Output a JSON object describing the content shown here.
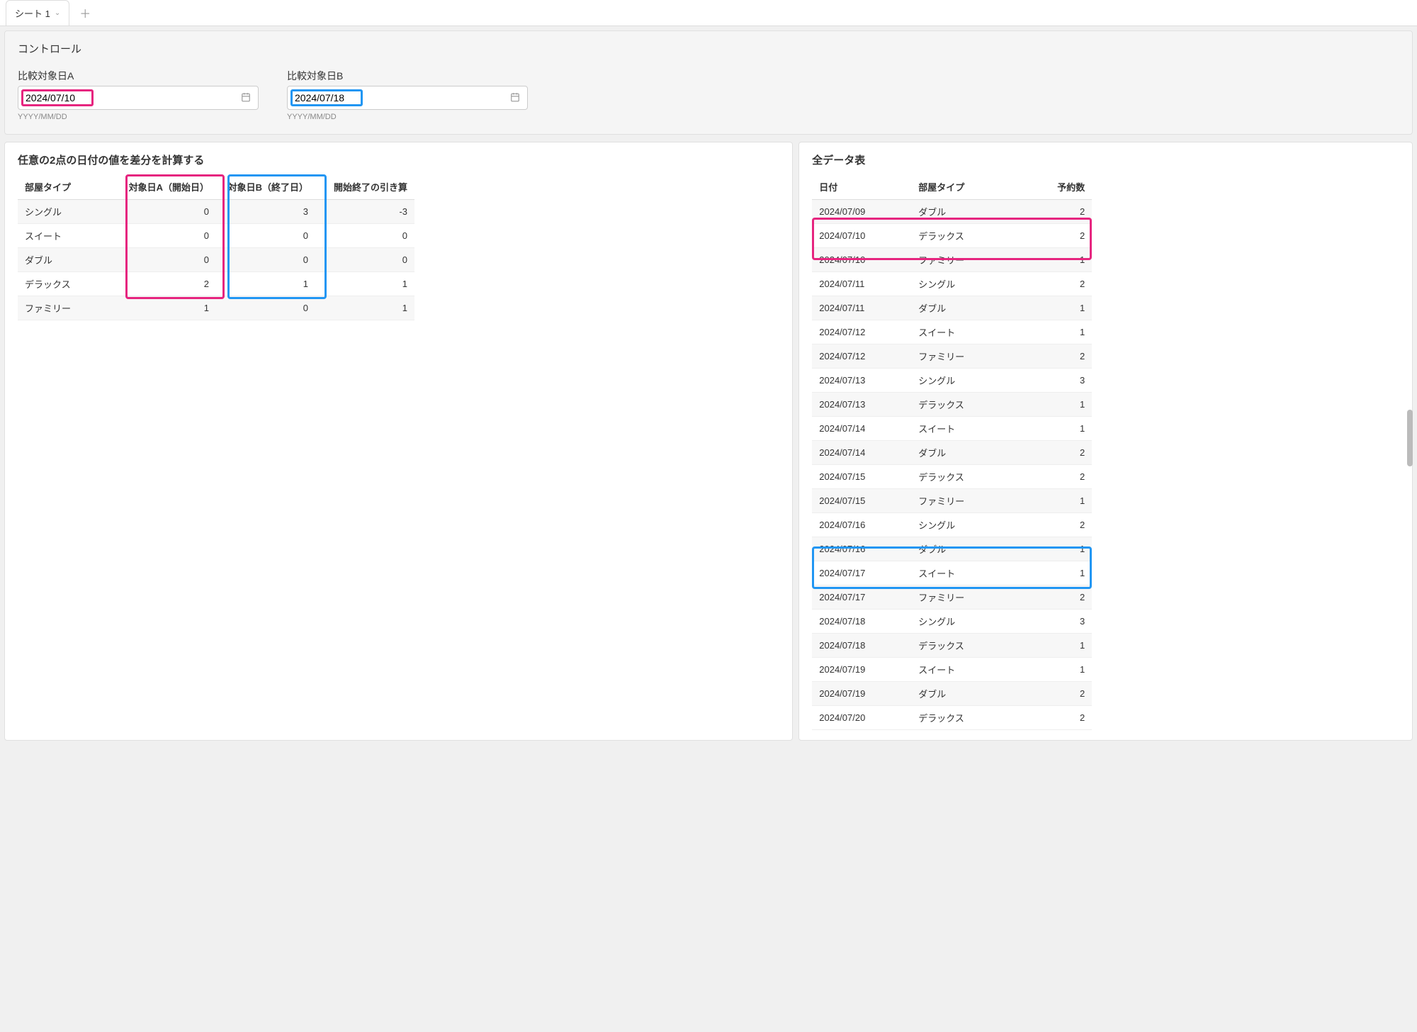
{
  "tabs": {
    "active": "シート 1"
  },
  "controls": {
    "title": "コントロール",
    "dateA": {
      "label": "比較対象日A",
      "value": "2024/07/10",
      "helper": "YYYY/MM/DD"
    },
    "dateB": {
      "label": "比較対象日B",
      "value": "2024/07/18",
      "helper": "YYYY/MM/DD"
    }
  },
  "leftPanel": {
    "title": "任意の2点の日付の値を差分を計算する",
    "headers": [
      "部屋タイプ",
      "対象日A（開始日）",
      "対象日B（終了日）",
      "開始終了の引き算"
    ],
    "rows": [
      {
        "room": "シングル",
        "a": 0,
        "b": 3,
        "diff": -3
      },
      {
        "room": "スイート",
        "a": 0,
        "b": 0,
        "diff": 0
      },
      {
        "room": "ダブル",
        "a": 0,
        "b": 0,
        "diff": 0
      },
      {
        "room": "デラックス",
        "a": 2,
        "b": 1,
        "diff": 1
      },
      {
        "room": "ファミリー",
        "a": 1,
        "b": 0,
        "diff": 1
      }
    ]
  },
  "rightPanel": {
    "title": "全データ表",
    "headers": [
      "日付",
      "部屋タイプ",
      "予約数"
    ],
    "rows": [
      {
        "date": "2024/07/09",
        "room": "ダブル",
        "count": 2
      },
      {
        "date": "2024/07/10",
        "room": "デラックス",
        "count": 2
      },
      {
        "date": "2024/07/10",
        "room": "ファミリー",
        "count": 1
      },
      {
        "date": "2024/07/11",
        "room": "シングル",
        "count": 2
      },
      {
        "date": "2024/07/11",
        "room": "ダブル",
        "count": 1
      },
      {
        "date": "2024/07/12",
        "room": "スイート",
        "count": 1
      },
      {
        "date": "2024/07/12",
        "room": "ファミリー",
        "count": 2
      },
      {
        "date": "2024/07/13",
        "room": "シングル",
        "count": 3
      },
      {
        "date": "2024/07/13",
        "room": "デラックス",
        "count": 1
      },
      {
        "date": "2024/07/14",
        "room": "スイート",
        "count": 1
      },
      {
        "date": "2024/07/14",
        "room": "ダブル",
        "count": 2
      },
      {
        "date": "2024/07/15",
        "room": "デラックス",
        "count": 2
      },
      {
        "date": "2024/07/15",
        "room": "ファミリー",
        "count": 1
      },
      {
        "date": "2024/07/16",
        "room": "シングル",
        "count": 2
      },
      {
        "date": "2024/07/16",
        "room": "ダブル",
        "count": 1
      },
      {
        "date": "2024/07/17",
        "room": "スイート",
        "count": 1
      },
      {
        "date": "2024/07/17",
        "room": "ファミリー",
        "count": 2
      },
      {
        "date": "2024/07/18",
        "room": "シングル",
        "count": 3
      },
      {
        "date": "2024/07/18",
        "room": "デラックス",
        "count": 1
      },
      {
        "date": "2024/07/19",
        "room": "スイート",
        "count": 1
      },
      {
        "date": "2024/07/19",
        "room": "ダブル",
        "count": 2
      },
      {
        "date": "2024/07/20",
        "room": "デラックス",
        "count": 2
      }
    ],
    "highlightPinkRows": [
      1,
      2
    ],
    "highlightBlueRows": [
      17,
      18
    ]
  }
}
